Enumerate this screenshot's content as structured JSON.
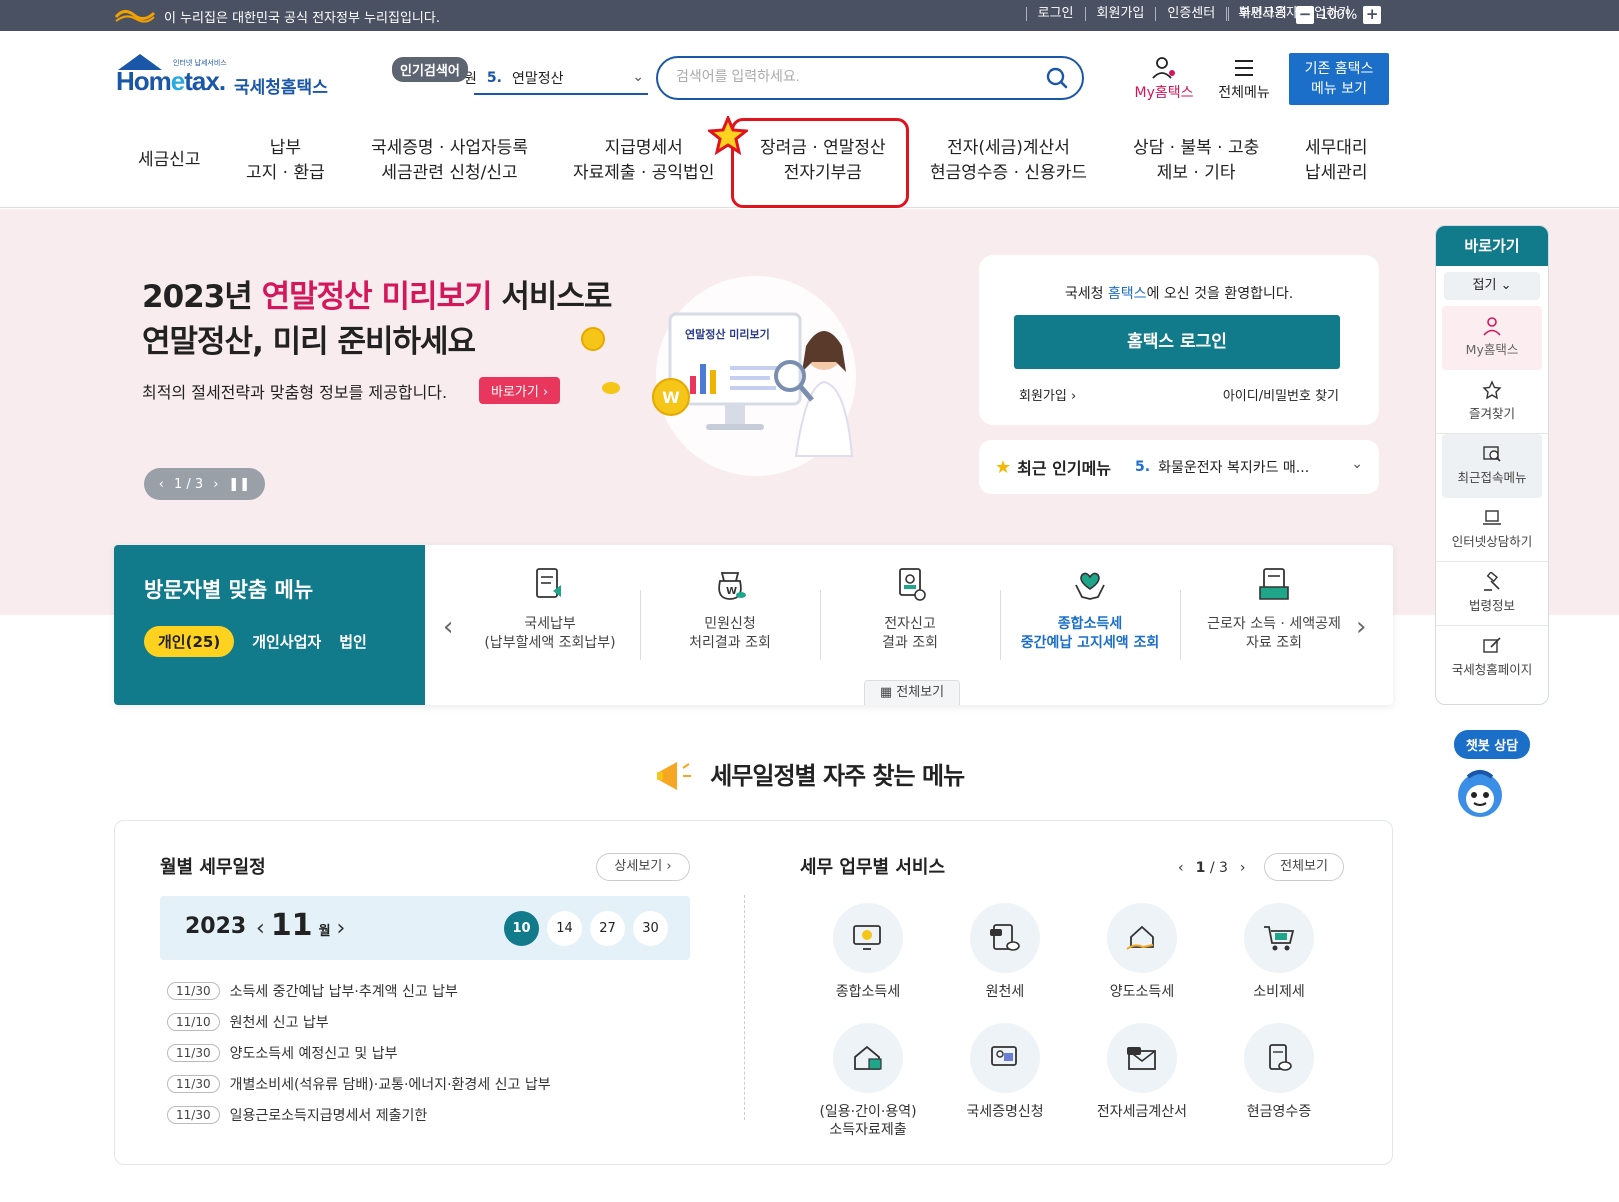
{
  "gov_bar": {
    "text": "이 누리집은 대한민국 공식 전자정부 누리집입니다.",
    "links": [
      "로그인",
      "회원가입",
      "인증센터",
      "부서사용자 가입하기"
    ],
    "font_size_label": "화면크기",
    "zoom": "100%",
    "zoom_out": "−",
    "zoom_in": "+"
  },
  "header": {
    "logo_home": "Hom",
    "logo_e": "e",
    "logo_tax": "tax.",
    "logo_tag": "인터넷 납세서비스",
    "logo_name": "국세청홈택스",
    "popular_badge": "인기검색어",
    "popular_prefix": "원",
    "popular_num": "5.",
    "popular_value": "연말정산",
    "search_placeholder": "검색어를 입력하세요.",
    "my_hometax": "My홈택스",
    "all_menu": "전체메뉴",
    "old_menu_line1": "기존 홈택스",
    "old_menu_line2": "메뉴 보기"
  },
  "nav": [
    {
      "l1": "세금신고",
      "l2": ""
    },
    {
      "l1": "납부",
      "l2": "고지 · 환급"
    },
    {
      "l1": "국세증명 · 사업자등록",
      "l2": "세금관련 신청/신고"
    },
    {
      "l1": "지급명세서",
      "l2": "자료제출 · 공익법인"
    },
    {
      "l1": "장려금 · 연말정산",
      "l2": "전자기부금"
    },
    {
      "l1": "전자(세금)계산서",
      "l2": "현금영수증 · 신용카드"
    },
    {
      "l1": "상담 · 불복 · 고충",
      "l2": "제보 · 기타"
    },
    {
      "l1": "세무대리",
      "l2": "납세관리"
    }
  ],
  "hero": {
    "title_a": "2023년 ",
    "title_pink": "연말정산 미리보기",
    "title_b": " 서비스로",
    "title2": "연말정산, 미리 준비하세요",
    "sub": "최적의 절세전략과 맞춤형 정보를 제공합니다.",
    "go": "바로가기",
    "pager": "1 / 3",
    "illust_label": "연말정산 미리보기",
    "coin": "W"
  },
  "login": {
    "welcome_a": "국세청 ",
    "welcome_blue": "홈택스",
    "welcome_b": "에 오신 것을 환영합니다.",
    "login_btn": "홈택스 로그인",
    "join": "회원가입",
    "find": "아이디/비밀번호 찾기"
  },
  "recent_popular": {
    "label": "최근 인기메뉴",
    "num": "5.",
    "value": "화물운전자 복지카드 매..."
  },
  "quick": {
    "title": "바로가기",
    "fold": "접기",
    "items": [
      "My홈택스",
      "즐겨찾기",
      "최근접속메뉴",
      "인터넷상담하기",
      "법령정보",
      "국세청홈페이지"
    ]
  },
  "chatbot": {
    "label": "챗봇 상담"
  },
  "visitor": {
    "title": "방문자별 맞춤 메뉴",
    "tabs": [
      "개인(25)",
      "개인사업자",
      "법인"
    ],
    "items": [
      {
        "l1": "국세납부",
        "l2": "(납부할세액 조회납부)"
      },
      {
        "l1": "민원신청",
        "l2": "처리결과 조회"
      },
      {
        "l1": "전자신고",
        "l2": "결과 조회"
      },
      {
        "l1": "종합소득세",
        "l2": "중간예납 고지세액 조회"
      },
      {
        "l1": "근로자 소득 · 세액공제",
        "l2": "자료 조회"
      }
    ],
    "view_all": "전체보기"
  },
  "section_title": "세무일정별 자주 찾는 메뉴",
  "monthly": {
    "title": "월별 세무일정",
    "detail": "상세보기",
    "year": "2023",
    "month": "11",
    "month_unit": "월",
    "days": [
      "10",
      "14",
      "27",
      "30"
    ],
    "schedule": [
      {
        "date": "11/30",
        "text": "소득세 중간예납 납부·추계액 신고 납부"
      },
      {
        "date": "11/10",
        "text": "원천세 신고 납부"
      },
      {
        "date": "11/30",
        "text": "양도소득세 예정신고 및 납부"
      },
      {
        "date": "11/30",
        "text": "개별소비세(석유류 담배)·교통·에너지·환경세 신고 납부"
      },
      {
        "date": "11/30",
        "text": "일용근로소득지급명세서 제출기한"
      }
    ]
  },
  "services": {
    "title": "세무 업무별 서비스",
    "pager_cur": "1",
    "pager_total": "/ 3",
    "view_all": "전체보기",
    "items": [
      {
        "l1": "종합소득세",
        "l2": ""
      },
      {
        "l1": "원천세",
        "l2": ""
      },
      {
        "l1": "양도소득세",
        "l2": ""
      },
      {
        "l1": "소비제세",
        "l2": ""
      },
      {
        "l1": "(일용·간이·용역)",
        "l2": "소득자료제출"
      },
      {
        "l1": "국세증명신청",
        "l2": ""
      },
      {
        "l1": "전자세금계산서",
        "l2": ""
      },
      {
        "l1": "현금영수증",
        "l2": ""
      }
    ]
  },
  "colors": {
    "primary": "#117a8b",
    "brand_blue": "#1b57a9",
    "accent_pink": "#d4165a",
    "highlight_red": "#e1141e"
  }
}
